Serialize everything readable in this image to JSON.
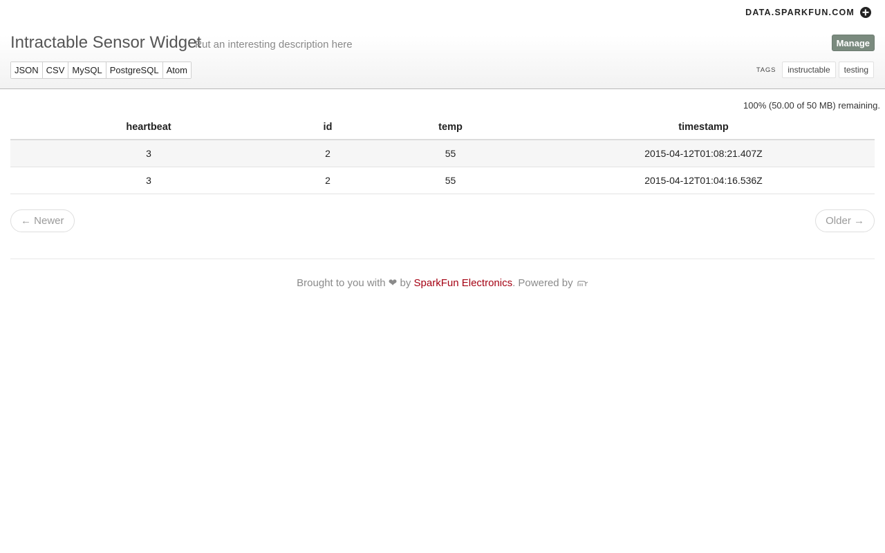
{
  "header": {
    "brand": "DATA.SPARKFUN.COM",
    "brand_icon": "plus-circle-icon",
    "title": "Intractable Sensor Widget",
    "description": "Put an interesting description here",
    "manage_label": "Manage",
    "formats": [
      "JSON",
      "CSV",
      "MySQL",
      "PostgreSQL",
      "Atom"
    ],
    "tags_label": "TAGS",
    "tags": [
      "instructable",
      "testing"
    ]
  },
  "storage": {
    "remaining_text": "100% (50.00 of 50 MB) remaining."
  },
  "table": {
    "columns": [
      "heartbeat",
      "id",
      "temp",
      "timestamp"
    ],
    "rows": [
      [
        "3",
        "2",
        "55",
        "2015-04-12T01:08:21.407Z"
      ],
      [
        "3",
        "2",
        "55",
        "2015-04-12T01:04:16.536Z"
      ]
    ]
  },
  "pager": {
    "newer_label": "← Newer",
    "older_label": "Older →"
  },
  "footer": {
    "prefix": "Brought to you with",
    "heart": "❤",
    "by": "by",
    "link_text": "SparkFun Electronics",
    "suffix": ". Powered by",
    "powered_icon": "phant-logo-icon"
  },
  "colors": {
    "manage_button": "#7a8a7e",
    "link": "#a40012"
  }
}
